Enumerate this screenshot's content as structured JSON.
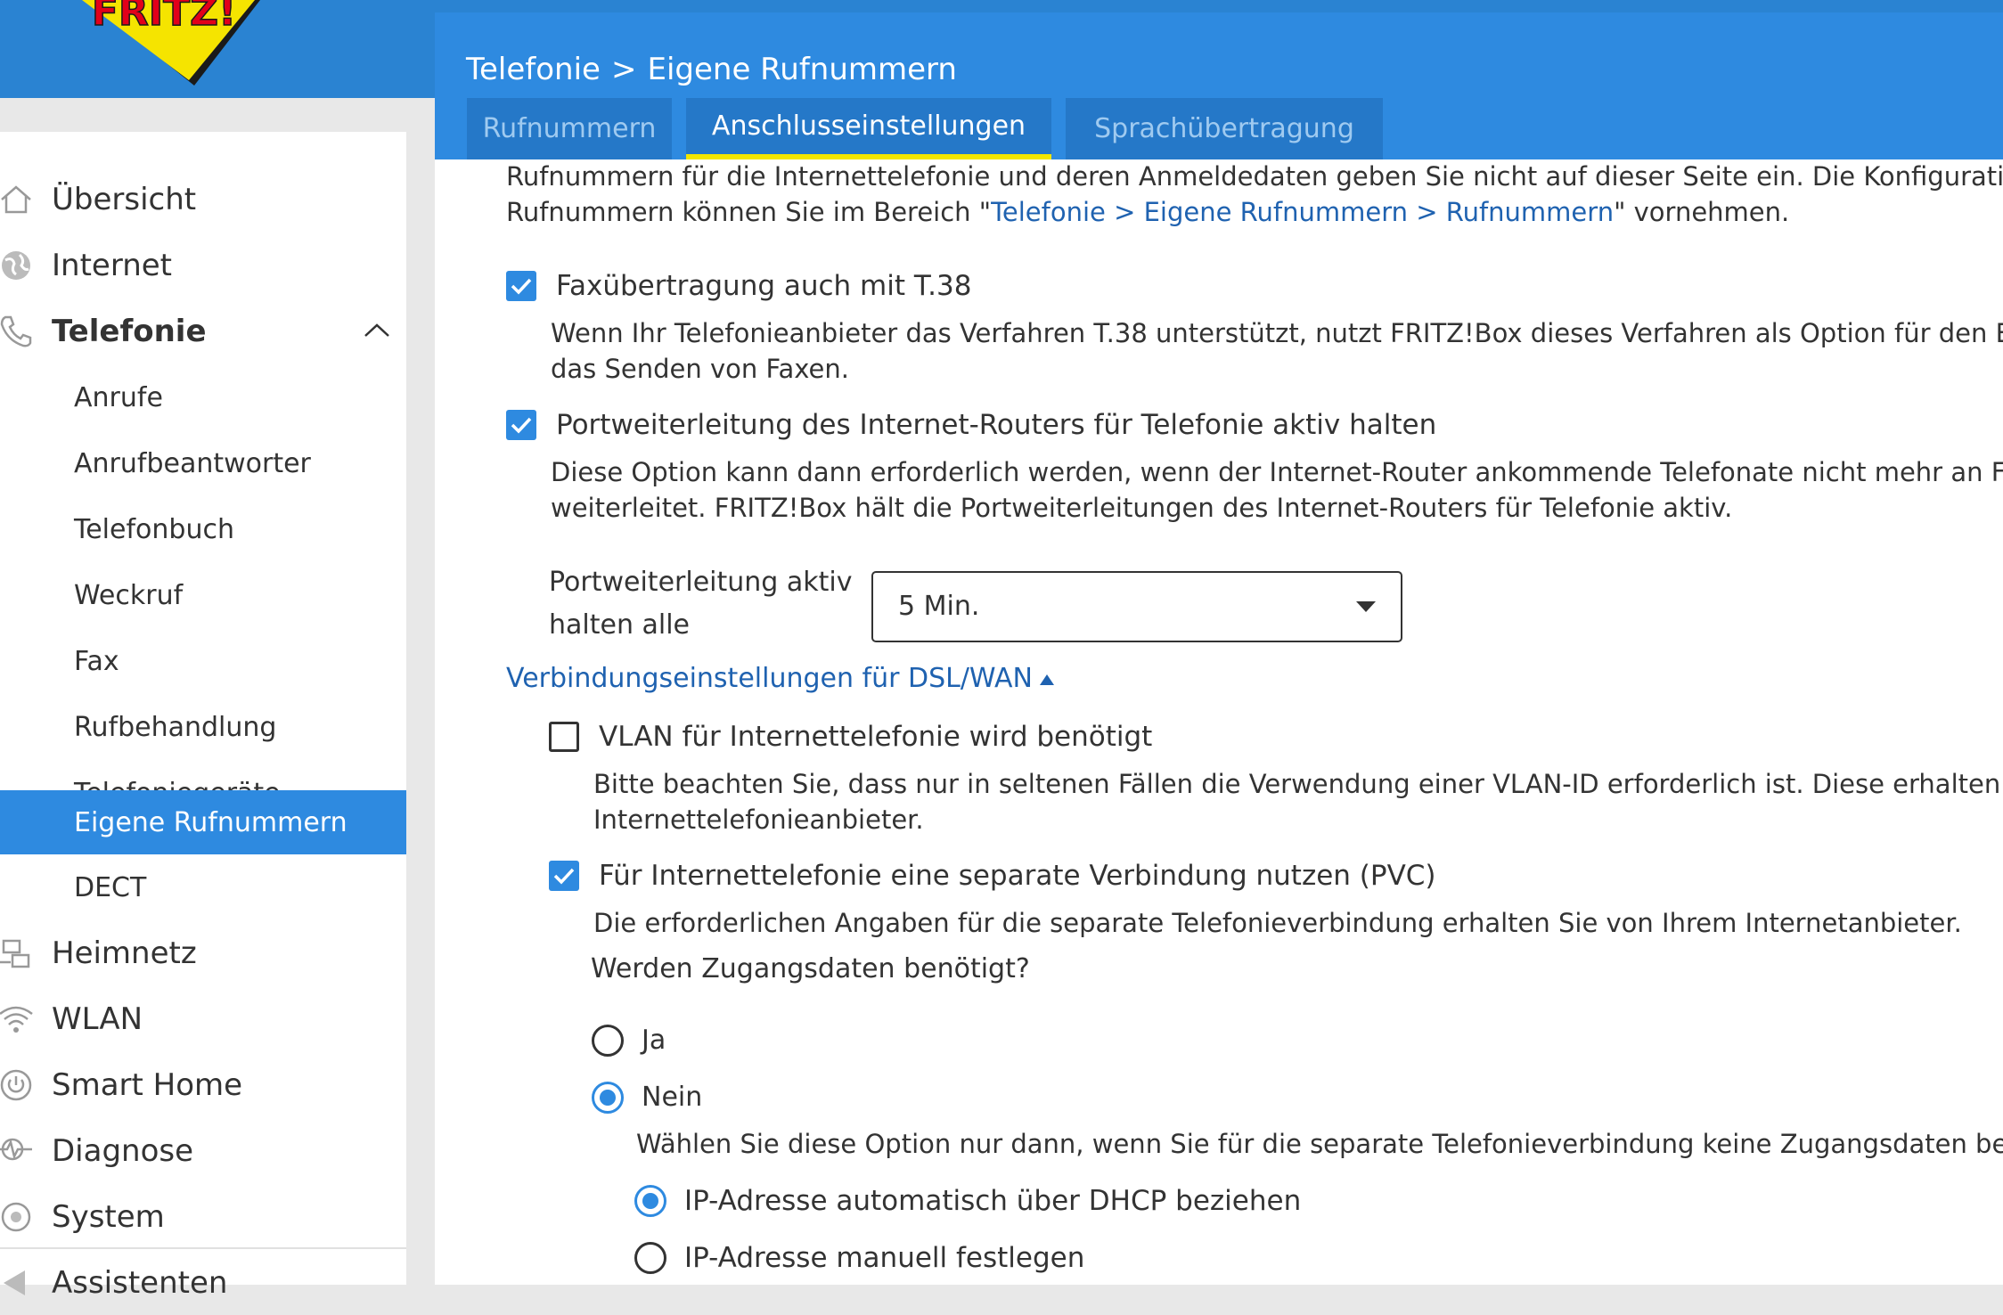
{
  "colors": {
    "topbar": "#2a83d2",
    "header": "#2e8ae0",
    "tab_bg": "#2578c8",
    "tab_active_underline": "#f2e600",
    "link": "#1f62b0",
    "logo_yellow": "#f5e400",
    "logo_red": "#e2001a"
  },
  "logo": {
    "text": "FRITZ!"
  },
  "breadcrumb": {
    "section": "Telefonie",
    "separator": ">",
    "page": "Eigene Rufnummern"
  },
  "tabs": [
    {
      "label": "Rufnummern",
      "active": false
    },
    {
      "label": "Anschlusseinstellungen",
      "active": true
    },
    {
      "label": "Sprachübertragung",
      "active": false
    }
  ],
  "sidebar": {
    "items": [
      {
        "label": "Übersicht",
        "icon": "home-icon"
      },
      {
        "label": "Internet",
        "icon": "globe-icon"
      },
      {
        "label": "Telefonie",
        "icon": "phone-icon",
        "expanded": true
      },
      {
        "label": "Anrufe"
      },
      {
        "label": "Anrufbeantworter"
      },
      {
        "label": "Telefonbuch"
      },
      {
        "label": "Weckruf"
      },
      {
        "label": "Fax"
      },
      {
        "label": "Rufbehandlung"
      },
      {
        "label": "Telefoniegeräte"
      },
      {
        "label": "Eigene Rufnummern",
        "active": true
      },
      {
        "label": "DECT"
      },
      {
        "label": "Heimnetz",
        "icon": "network-icon"
      },
      {
        "label": "WLAN",
        "icon": "wifi-icon"
      },
      {
        "label": "Smart Home",
        "icon": "power-icon"
      },
      {
        "label": "Diagnose",
        "icon": "pulse-icon"
      },
      {
        "label": "System",
        "icon": "system-icon"
      },
      {
        "label": "Assistenten",
        "icon": "wizard-icon"
      }
    ]
  },
  "intro": {
    "line1": "Rufnummern für die Internettelefonie und deren Anmeldedaten geben Sie nicht auf dieser Seite ein. Die Konfiguration der",
    "line2_prefix": "Rufnummern können Sie im Bereich \"",
    "line2_link": "Telefonie > Eigene Rufnummern > Rufnummern",
    "line2_suffix": "\" vornehmen."
  },
  "options": {
    "fax": {
      "checked": true,
      "label": "Faxübertragung auch mit T.38",
      "desc1": "Wenn Ihr Telefonieanbieter das Verfahren T.38 unterstützt, nutzt FRITZ!Box dieses Verfahren als Option für den Empfang und",
      "desc2": "das Senden von Faxen."
    },
    "port": {
      "checked": true,
      "label": "Portweiterleitung des Internet-Routers für Telefonie aktiv halten",
      "desc1": "Diese Option kann dann erforderlich werden, wenn der Internet-Router ankommende Telefonate nicht mehr an FRITZ!Box",
      "desc2": "weiterleitet. FRITZ!Box hält die Portweiterleitungen des Internet-Routers für Telefonie aktiv."
    },
    "keepalive": {
      "label1": "Portweiterleitung aktiv",
      "label2": "halten alle",
      "value": "5 Min."
    }
  },
  "dsl": {
    "link": "Verbindungseinstellungen für DSL/WAN",
    "vlan": {
      "checked": false,
      "label": "VLAN für Internettelefonie wird benötigt",
      "desc1": "Bitte beachten Sie, dass nur in seltenen Fällen die Verwendung einer VLAN-ID erforderlich ist. Diese erhalten Sie von Ihrem",
      "desc2": "Internettelefonieanbieter."
    },
    "pvc": {
      "checked": true,
      "label": "Für Internettelefonie eine separate Verbindung nutzen (PVC)",
      "desc": "Die erforderlichen Angaben für die separate Telefonieverbindung erhalten Sie von Ihrem Internetanbieter.",
      "question": "Werden Zugangsdaten benötigt?",
      "yes": "Ja",
      "no": "Nein",
      "no_selected": true,
      "no_desc": "Wählen Sie diese Option nur dann, wenn Sie für die separate Telefonieverbindung keine Zugangsdaten benötigen.",
      "ip_auto": "IP-Adresse automatisch über DHCP beziehen",
      "ip_manual": "IP-Adresse manuell festlegen",
      "ip_auto_selected": true
    }
  }
}
